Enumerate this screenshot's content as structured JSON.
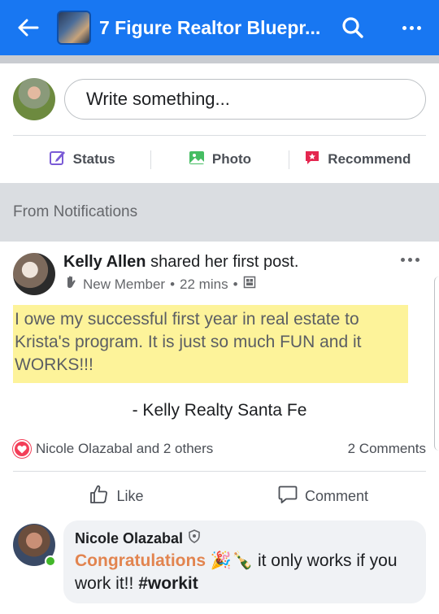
{
  "header": {
    "title": "7 Figure Realtor Bluepr..."
  },
  "composer": {
    "placeholder": "Write something...",
    "actions": [
      {
        "label": "Status",
        "icon": "edit-icon"
      },
      {
        "label": "Photo",
        "icon": "photo-icon"
      },
      {
        "label": "Recommend",
        "icon": "recommend-icon"
      }
    ]
  },
  "section": {
    "title": "From Notifications"
  },
  "post": {
    "author": "Kelly Allen",
    "headline_rest": " shared her first post.",
    "badge": "New Member",
    "time": "22 mins",
    "body": "I owe my successful first year in real estate to Krista's program. It is just so much FUN and it WORKS!!!",
    "signature": "- Kelly Realty Santa Fe",
    "reactions_text": "Nicole Olazabal and 2 others",
    "comments_count": "2 Comments",
    "like_label": "Like",
    "comment_label": "Comment"
  },
  "comment": {
    "author": "Nicole Olazabal",
    "highlight": "Congratulations",
    "emoji": "🎉🍾",
    "text_rest": " it only works if you work it!! ",
    "hashtag": "#workit"
  },
  "colors": {
    "brand": "#1877f2",
    "highlight": "#fdf39a",
    "congrats": "#e2844f",
    "heart": "#f33e58"
  }
}
